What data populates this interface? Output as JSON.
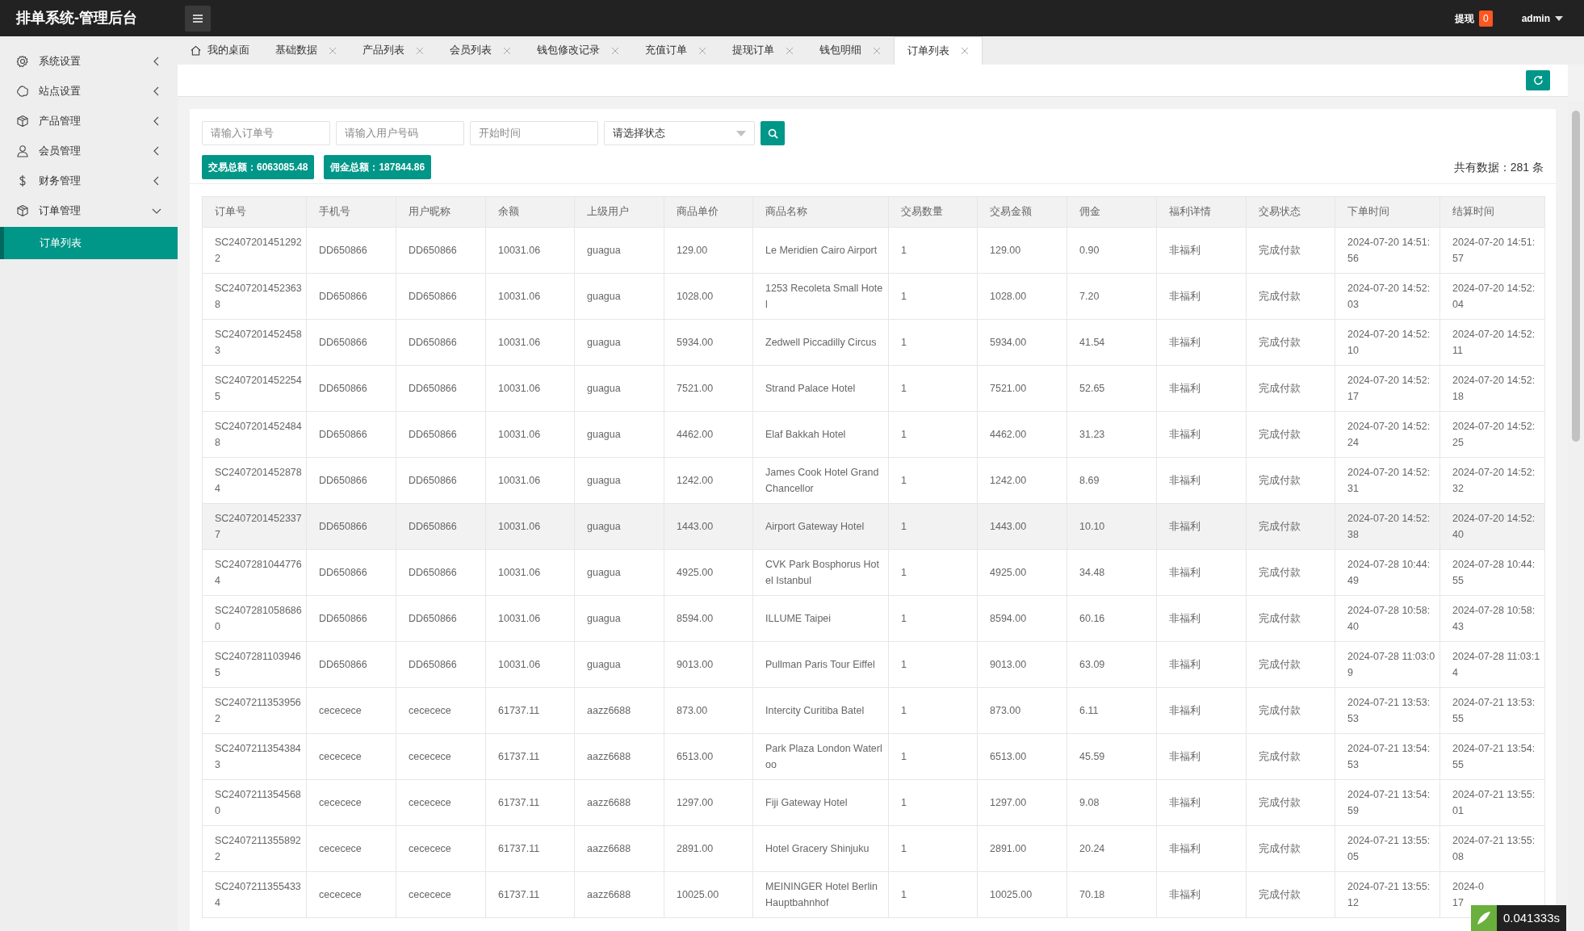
{
  "header": {
    "title": "排单系统-管理后台",
    "withdraw": {
      "label": "提现",
      "count": "0"
    },
    "user": "admin"
  },
  "sidebar": {
    "items": [
      {
        "label": "系统设置",
        "expanded": false
      },
      {
        "label": "站点设置",
        "expanded": false
      },
      {
        "label": "产品管理",
        "expanded": false
      },
      {
        "label": "会员管理",
        "expanded": false
      },
      {
        "label": "财务管理",
        "expanded": false
      },
      {
        "label": "订单管理",
        "expanded": true,
        "children": [
          {
            "label": "订单列表",
            "selected": true
          }
        ]
      }
    ]
  },
  "tabs": [
    {
      "label": "我的桌面",
      "kind": "home",
      "selected": false
    },
    {
      "label": "基础数据",
      "kind": "closable",
      "selected": false
    },
    {
      "label": "产品列表",
      "kind": "closable",
      "selected": false
    },
    {
      "label": "会员列表",
      "kind": "closable",
      "selected": false
    },
    {
      "label": "钱包修改记录",
      "kind": "closable",
      "selected": false
    },
    {
      "label": "充值订单",
      "kind": "closable",
      "selected": false
    },
    {
      "label": "提现订单",
      "kind": "closable",
      "selected": false
    },
    {
      "label": "钱包明细",
      "kind": "closable",
      "selected": false
    },
    {
      "label": "订单列表",
      "kind": "closable",
      "selected": true
    }
  ],
  "filters": {
    "order_no": {
      "placeholder": "请输入订单号"
    },
    "user_no": {
      "placeholder": "请输入用户号码"
    },
    "start_time": {
      "placeholder": "开始时间"
    },
    "status": {
      "value": "请选择状态"
    }
  },
  "summary": [
    "交易总额：6063085.48",
    "佣金总额：187844.86"
  ],
  "total": "共有数据：281 条",
  "table": {
    "columns": [
      "订单号",
      "手机号",
      "用户昵称",
      "余额",
      "上级用户",
      "商品单价",
      "商品名称",
      "交易数量",
      "交易金额",
      "佣金",
      "福利详情",
      "交易状态",
      "下单时间",
      "结算时间"
    ],
    "rows": [
      {
        "highlighted": false,
        "cells": [
          "SC24072014512922",
          "DD650866",
          "DD650866",
          "10031.06",
          "guagua",
          "129.00",
          "Le Meridien Cairo Airport",
          "1",
          "129.00",
          "0.90",
          "非福利",
          "完成付款",
          "2024-07-20 14:51:56",
          "2024-07-20 14:51:57"
        ]
      },
      {
        "highlighted": false,
        "cells": [
          "SC24072014523638",
          "DD650866",
          "DD650866",
          "10031.06",
          "guagua",
          "1028.00",
          "1253 Recoleta Small Hotel",
          "1",
          "1028.00",
          "7.20",
          "非福利",
          "完成付款",
          "2024-07-20 14:52:03",
          "2024-07-20 14:52:04"
        ]
      },
      {
        "highlighted": false,
        "cells": [
          "SC24072014524583",
          "DD650866",
          "DD650866",
          "10031.06",
          "guagua",
          "5934.00",
          "Zedwell Piccadilly Circus",
          "1",
          "5934.00",
          "41.54",
          "非福利",
          "完成付款",
          "2024-07-20 14:52:10",
          "2024-07-20 14:52:11"
        ]
      },
      {
        "highlighted": false,
        "cells": [
          "SC24072014522545",
          "DD650866",
          "DD650866",
          "10031.06",
          "guagua",
          "7521.00",
          "Strand Palace Hotel",
          "1",
          "7521.00",
          "52.65",
          "非福利",
          "完成付款",
          "2024-07-20 14:52:17",
          "2024-07-20 14:52:18"
        ]
      },
      {
        "highlighted": false,
        "cells": [
          "SC24072014524848",
          "DD650866",
          "DD650866",
          "10031.06",
          "guagua",
          "4462.00",
          "Elaf Bakkah Hotel",
          "1",
          "4462.00",
          "31.23",
          "非福利",
          "完成付款",
          "2024-07-20 14:52:24",
          "2024-07-20 14:52:25"
        ]
      },
      {
        "highlighted": false,
        "cells": [
          "SC24072014528784",
          "DD650866",
          "DD650866",
          "10031.06",
          "guagua",
          "1242.00",
          "James Cook Hotel Grand Chancellor",
          "1",
          "1242.00",
          "8.69",
          "非福利",
          "完成付款",
          "2024-07-20 14:52:31",
          "2024-07-20 14:52:32"
        ]
      },
      {
        "highlighted": true,
        "cells": [
          "SC24072014523377",
          "DD650866",
          "DD650866",
          "10031.06",
          "guagua",
          "1443.00",
          "Airport Gateway Hotel",
          "1",
          "1443.00",
          "10.10",
          "非福利",
          "完成付款",
          "2024-07-20 14:52:38",
          "2024-07-20 14:52:40"
        ]
      },
      {
        "highlighted": false,
        "cells": [
          "SC24072810447764",
          "DD650866",
          "DD650866",
          "10031.06",
          "guagua",
          "4925.00",
          "CVK Park Bosphorus Hotel Istanbul",
          "1",
          "4925.00",
          "34.48",
          "非福利",
          "完成付款",
          "2024-07-28 10:44:49",
          "2024-07-28 10:44:55"
        ]
      },
      {
        "highlighted": false,
        "cells": [
          "SC24072810586860",
          "DD650866",
          "DD650866",
          "10031.06",
          "guagua",
          "8594.00",
          "ILLUME Taipei",
          "1",
          "8594.00",
          "60.16",
          "非福利",
          "完成付款",
          "2024-07-28 10:58:40",
          "2024-07-28 10:58:43"
        ]
      },
      {
        "highlighted": false,
        "cells": [
          "SC24072811039465",
          "DD650866",
          "DD650866",
          "10031.06",
          "guagua",
          "9013.00",
          "Pullman Paris Tour Eiffel",
          "1",
          "9013.00",
          "63.09",
          "非福利",
          "完成付款",
          "2024-07-28 11:03:09",
          "2024-07-28 11:03:14"
        ]
      },
      {
        "highlighted": false,
        "cells": [
          "SC24072113539562",
          "cececece",
          "cececece",
          "61737.11",
          "aazz6688",
          "873.00",
          "Intercity Curitiba Batel",
          "1",
          "873.00",
          "6.11",
          "非福利",
          "完成付款",
          "2024-07-21 13:53:53",
          "2024-07-21 13:53:55"
        ]
      },
      {
        "highlighted": false,
        "cells": [
          "SC24072113543843",
          "cececece",
          "cececece",
          "61737.11",
          "aazz6688",
          "6513.00",
          "Park Plaza London Waterloo",
          "1",
          "6513.00",
          "45.59",
          "非福利",
          "完成付款",
          "2024-07-21 13:54:53",
          "2024-07-21 13:54:55"
        ]
      },
      {
        "highlighted": false,
        "cells": [
          "SC24072113545680",
          "cececece",
          "cececece",
          "61737.11",
          "aazz6688",
          "1297.00",
          "Fiji Gateway Hotel",
          "1",
          "1297.00",
          "9.08",
          "非福利",
          "完成付款",
          "2024-07-21 13:54:59",
          "2024-07-21 13:55:01"
        ]
      },
      {
        "highlighted": false,
        "cells": [
          "SC24072113558922",
          "cececece",
          "cececece",
          "61737.11",
          "aazz6688",
          "2891.00",
          "Hotel Gracery Shinjuku",
          "1",
          "2891.00",
          "20.24",
          "非福利",
          "完成付款",
          "2024-07-21 13:55:05",
          "2024-07-21 13:55:08"
        ]
      },
      {
        "highlighted": false,
        "cells": [
          "SC24072113554334",
          "cececece",
          "cececece",
          "61737.11",
          "aazz6688",
          "10025.00",
          "MEININGER Hotel Berlin Hauptbahnhof",
          "1",
          "10025.00",
          "70.18",
          "非福利",
          "完成付款",
          "2024-07-21 13:55:12",
          "2024-0\n17"
        ]
      }
    ]
  },
  "debug_timer": "0.041333s"
}
